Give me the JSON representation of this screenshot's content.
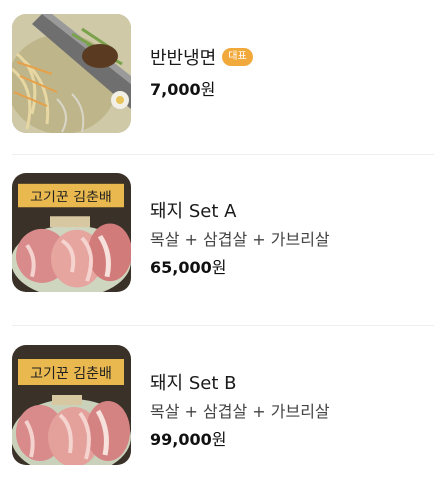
{
  "menu": {
    "items": [
      {
        "name": "반반냉면",
        "badge": "대표",
        "price": "7,000",
        "currency": "원",
        "image_icon": "cold-noodles-photo"
      },
      {
        "name": "돼지 Set A",
        "description": "목살 + 삼겹살 + 가브리살",
        "price": "65,000",
        "currency": "원",
        "image_icon": "pork-set-photo",
        "sign_text": "고기꾼 김춘배"
      },
      {
        "name": "돼지 Set B",
        "description": "목살 + 삼겹살 + 가브리살",
        "price": "99,000",
        "currency": "원",
        "image_icon": "pork-set-photo",
        "sign_text": "고기꾼 김춘배"
      }
    ]
  },
  "colors": {
    "badge": "#f2a93b",
    "divider": "#eeeeee",
    "text": "#1a1a1a"
  }
}
